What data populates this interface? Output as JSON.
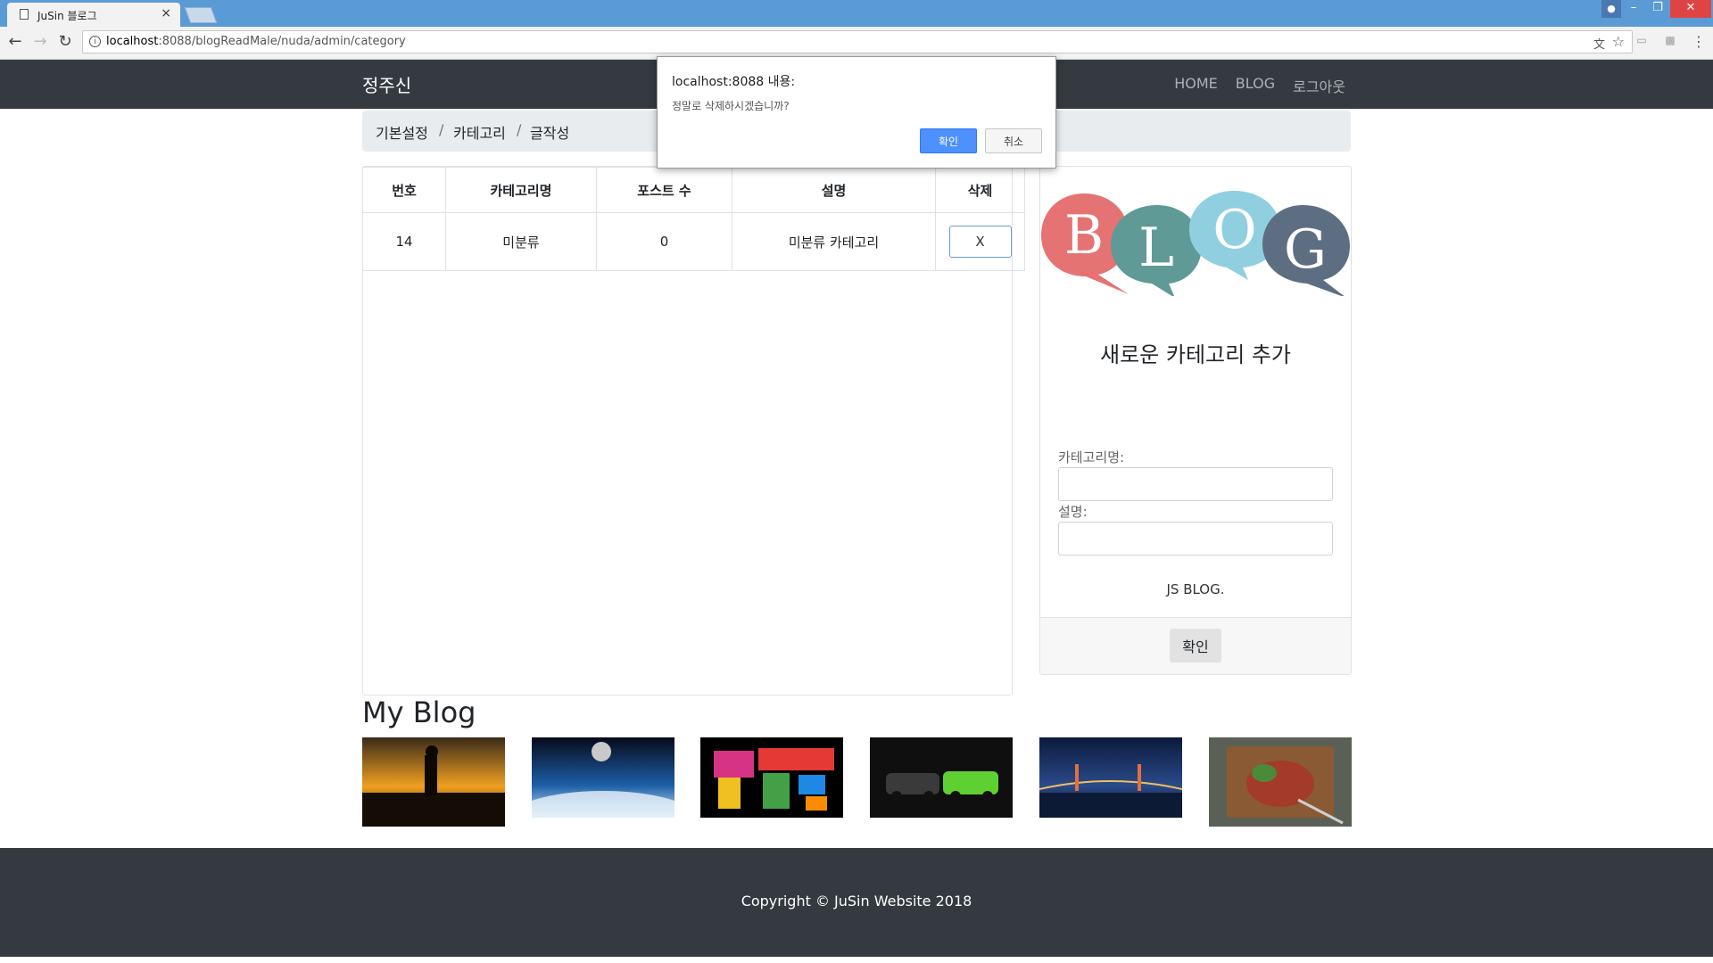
{
  "browser": {
    "tab_title": "JuSin 블로그",
    "tab_close": "×",
    "url_host": "localhost",
    "url_rest": ":8088/blogReadMale/nuda/admin/category"
  },
  "dialog": {
    "title": "localhost:8088 내용:",
    "message": "정말로 삭제하시겠습니까?",
    "ok_label": "확인",
    "cancel_label": "취소",
    "ok_color": "#4d90fe"
  },
  "navbar": {
    "brand": "정주신",
    "links": [
      "HOME",
      "BLOG",
      "로그아웃"
    ]
  },
  "breadcrumb": [
    "기본설정",
    "카테고리",
    "글작성"
  ],
  "table": {
    "headers": [
      "번호",
      "카테고리명",
      "포스트 수",
      "설명",
      "삭제"
    ],
    "rows": [
      {
        "id": "14",
        "name": "미분류",
        "posts": "0",
        "description": "미분류 카테고리",
        "delete_label": "X"
      }
    ]
  },
  "sidebar": {
    "logo_letters": [
      "B",
      "L",
      "O",
      "G"
    ],
    "title": "새로운 카테고리 추가",
    "name_label": "카테고리명:",
    "desc_label": "설명:",
    "note": "JS BLOG.",
    "confirm_label": "확인"
  },
  "myblog": {
    "title": "My Blog",
    "thumbnails": [
      "sunset-couple-photo",
      "earth-space-photo",
      "world-map-words-photo",
      "sports-cars-photo",
      "night-bridge-photo",
      "steak-food-photo"
    ]
  },
  "footer": {
    "copyright": "Copyright © JuSin Website 2018"
  },
  "colors": {
    "navbar": "#343a40",
    "tabbar": "#5b9bd5"
  }
}
